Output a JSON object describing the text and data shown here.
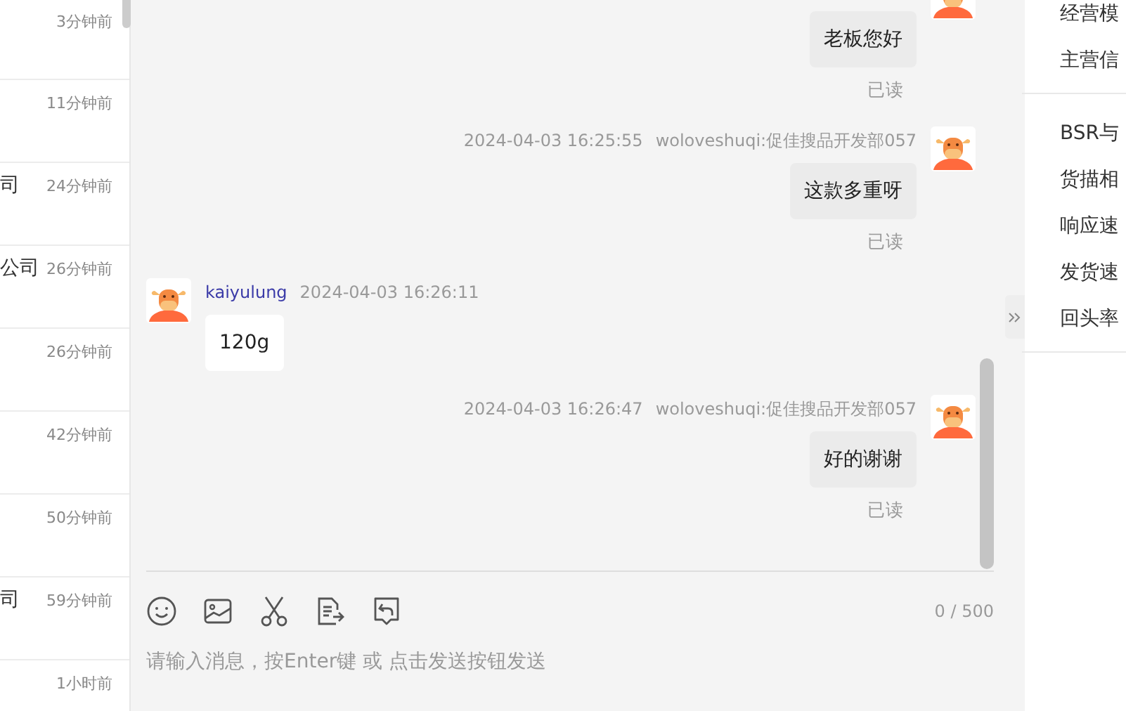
{
  "conversation_list": [
    {
      "time": "3分钟前"
    },
    {
      "time": "11分钟前"
    },
    {
      "name": "司",
      "time": "24分钟前"
    },
    {
      "name": "公司",
      "time": "26分钟前"
    },
    {
      "time": "26分钟前"
    },
    {
      "time": "42分钟前"
    },
    {
      "time": "50分钟前"
    },
    {
      "name": "司",
      "time": "59分钟前"
    },
    {
      "time": "1小时前"
    }
  ],
  "messages": [
    {
      "kind": "sent",
      "text": "老板您好",
      "status": "已读"
    },
    {
      "kind": "sent",
      "time": "2024-04-03 16:25:55",
      "sender": "woloveshuqi:促佳搜品开发部057",
      "text": "这款多重呀",
      "status": "已读"
    },
    {
      "kind": "received",
      "time": "2024-04-03 16:26:11",
      "sender": "kaiyulung",
      "text": "120g"
    },
    {
      "kind": "sent",
      "time": "2024-04-03 16:26:47",
      "sender": "woloveshuqi:促佳搜品开发部057",
      "text": "好的谢谢",
      "status": "已读"
    }
  ],
  "composer": {
    "counter": "0 / 500",
    "placeholder": "请输入消息，按Enter键 或 点击发送按钮发送"
  },
  "side_panel": {
    "groups": [
      [
        "经营模",
        "主营信"
      ],
      [
        "BSR与",
        "货描相",
        "响应速",
        "发货速",
        "回头率"
      ]
    ]
  }
}
